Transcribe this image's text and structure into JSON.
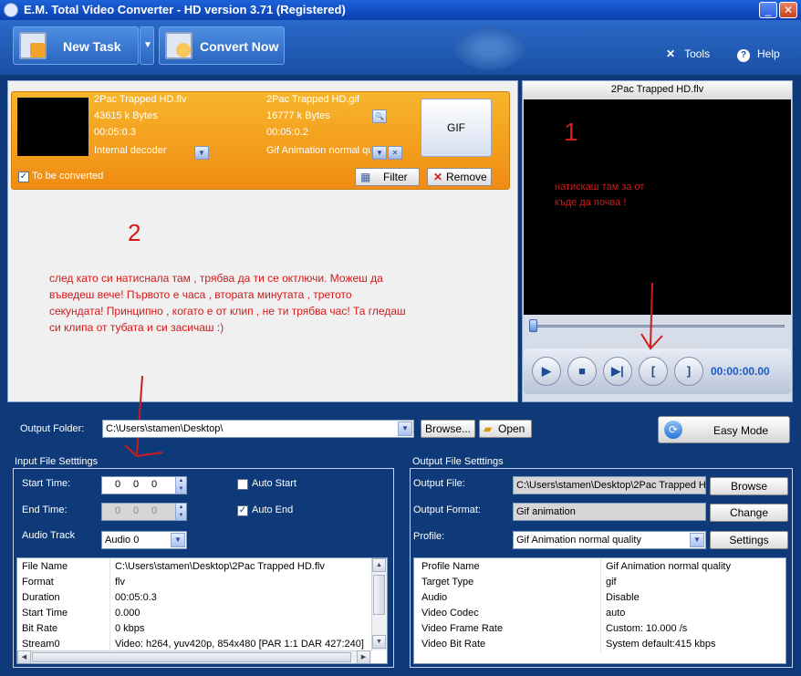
{
  "window": {
    "title": "E.M. Total Video Converter -  HD version 3.71 (Registered)"
  },
  "toolbar": {
    "new_task": "New Task",
    "convert_now": "Convert Now",
    "tools": "Tools",
    "help": "Help"
  },
  "task": {
    "src_name": "2Pac Trapped HD.flv",
    "src_size": "43615 k Bytes",
    "src_duration": "00:05:0.3",
    "decoder": "Internal decoder",
    "dst_name": "2Pac Trapped HD.gif",
    "dst_size": "16777 k Bytes",
    "dst_duration": "00:05:0.2",
    "dst_profile": "Gif Animation normal qua",
    "format_button": "GIF",
    "to_be_converted": "To be converted",
    "filter": "Filter",
    "remove": "Remove"
  },
  "preview": {
    "title": "2Pac Trapped HD.flv",
    "time": "00:00:00.00",
    "mark_in": "[",
    "mark_out": "]"
  },
  "annotations": {
    "one": "1",
    "one_text_line1": "натискаш там за от",
    "one_text_line2": "къде да почва !",
    "two": "2",
    "two_line1": "след като си натиснала там , трябва да ти се октлючи. Можеш да",
    "two_line2": "въведеш вече!  Първото е часа , втората минутата , третото",
    "two_line3": "секундата! Принципно , когато е от клип , не ти трябва час! Та гледаш",
    "two_line4": "си клипа от тубата и си засичаш :)"
  },
  "output_folder": {
    "label": "Output Folder:",
    "value": "C:\\Users\\stamen\\Desktop\\",
    "browse": "Browse...",
    "open": "Open",
    "easy_mode": "Easy Mode"
  },
  "input_settings": {
    "title": "Input File Setttings",
    "start_time_label": "Start Time:",
    "start_time": [
      "0",
      "0",
      "0"
    ],
    "end_time_label": "End Time:",
    "end_time": [
      "0",
      "0",
      "0"
    ],
    "auto_start": "Auto Start",
    "auto_end": "Auto End",
    "audio_track_label": "Audio Track",
    "audio_track": "Audio 0",
    "info": [
      {
        "k": "File Name",
        "v": "C:\\Users\\stamen\\Desktop\\2Pac Trapped HD.flv"
      },
      {
        "k": "Format",
        "v": "flv"
      },
      {
        "k": "Duration",
        "v": "00:05:0.3"
      },
      {
        "k": "Start Time",
        "v": "0.000"
      },
      {
        "k": "Bit Rate",
        "v": "0 kbps"
      },
      {
        "k": "Stream0",
        "v": "Video: h264, yuv420p, 854x480 [PAR 1:1 DAR 427:240]"
      }
    ]
  },
  "output_settings": {
    "title": "Output File Setttings",
    "output_file_label": "Output File:",
    "output_file": "C:\\Users\\stamen\\Desktop\\2Pac Trapped H",
    "browse": "Browse",
    "output_format_label": "Output Format:",
    "output_format": "Gif animation",
    "change": "Change",
    "profile_label": "Profile:",
    "profile": "Gif Animation normal quality",
    "settings": "Settings",
    "info": [
      {
        "k": "Profile Name",
        "v": "Gif Animation normal quality"
      },
      {
        "k": "Target Type",
        "v": "gif"
      },
      {
        "k": "Audio",
        "v": "Disable"
      },
      {
        "k": "Video Codec",
        "v": "auto"
      },
      {
        "k": "Video Frame Rate",
        "v": "Custom: 10.000 /s"
      },
      {
        "k": "Video Bit Rate",
        "v": "System default:415 kbps"
      }
    ]
  },
  "colors": {
    "background": "#0e3a7a",
    "task_card": "#f4a020",
    "annotation_red": "#d11a1a",
    "time_blue": "#1a5bc8"
  }
}
